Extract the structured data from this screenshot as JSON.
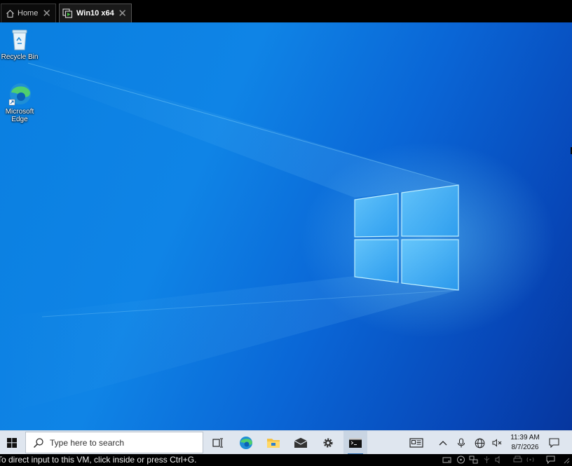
{
  "host": {
    "tabs": [
      {
        "label": "Home",
        "icon": "home-icon"
      },
      {
        "label": "Win10 x64",
        "icon": "vm-icon"
      }
    ],
    "status_message": "To direct input to this VM, click inside or press Ctrl+G."
  },
  "desktop": {
    "icons": [
      {
        "label": "Recycle Bin",
        "icon": "recycle-bin-icon"
      },
      {
        "label": "Microsoft Edge",
        "icon": "edge-icon"
      }
    ]
  },
  "taskbar": {
    "search_placeholder": "Type here to search",
    "pinned": [
      "start-icon",
      "task-view-icon",
      "edge-icon",
      "file-explorer-icon",
      "mail-icon",
      "settings-icon",
      "terminal-icon"
    ],
    "tray": [
      "news-icon",
      "chevron-up-icon",
      "microphone-icon",
      "network-icon",
      "volume-muted-icon"
    ],
    "clock": {
      "time": "11:39 AM",
      "date": "8/7/2026"
    }
  },
  "colors": {
    "accent": "#0a74da",
    "taskbar": "#dfe6ef",
    "running_indicator": "#2f6fb6"
  }
}
